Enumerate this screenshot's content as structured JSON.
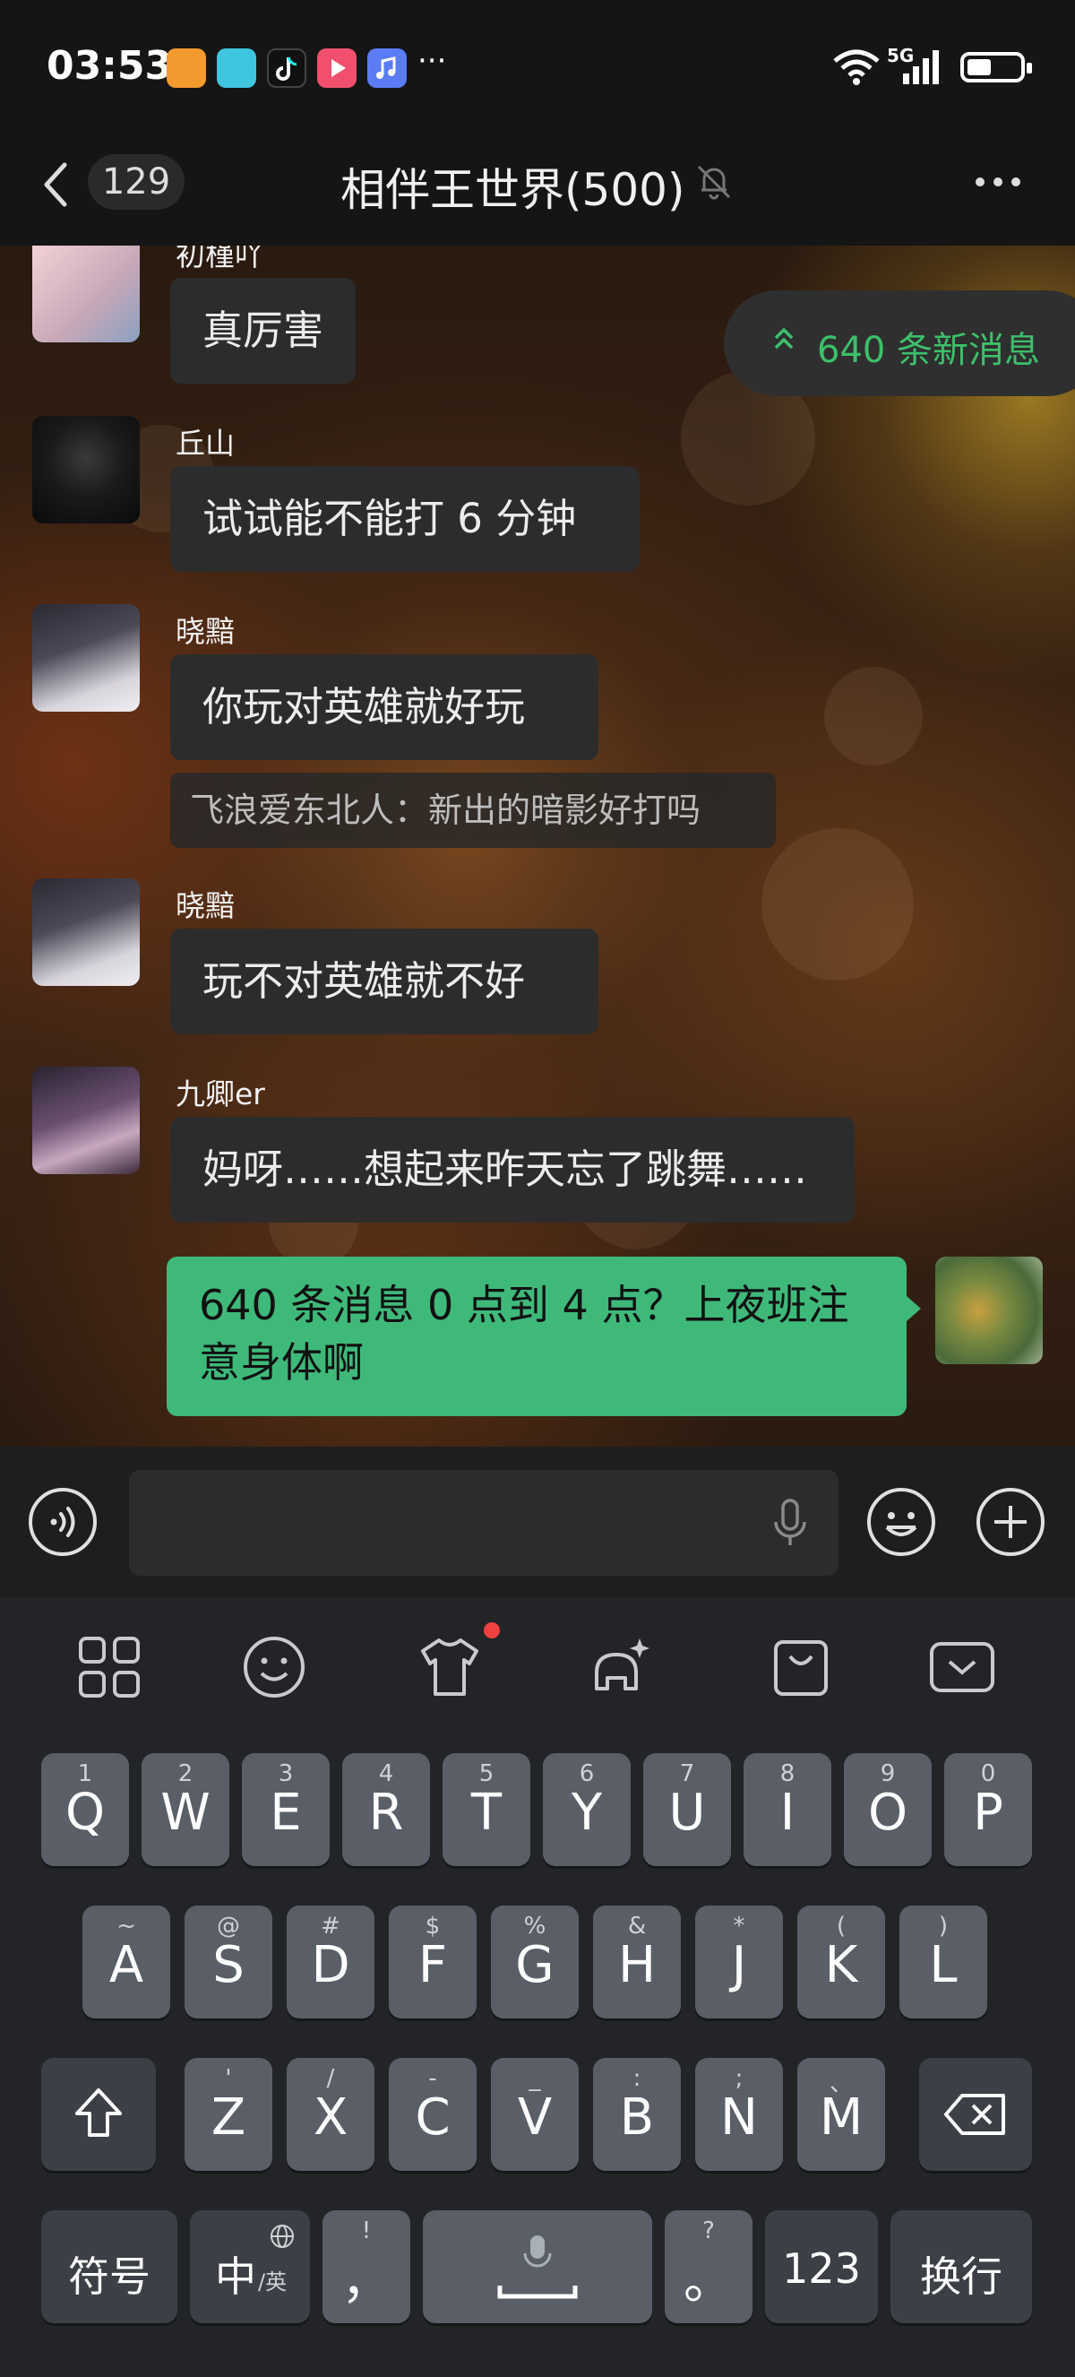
{
  "status_bar": {
    "time": "03:53",
    "network": "5G",
    "more": "···"
  },
  "header": {
    "unread_count": "129",
    "title": "相伴王世界(500)"
  },
  "new_messages_pill": "640 条新消息",
  "messages": [
    {
      "sender": "初槿吖",
      "text": "真厉害"
    },
    {
      "sender": "丘山",
      "text": "试试能不能打 6 分钟"
    },
    {
      "sender": "晓黯",
      "text": "你玩对英雄就好玩",
      "quote": "飞浪爱东北人：新出的暗影好打吗"
    },
    {
      "sender": "晓黯",
      "text": "玩不对英雄就不好"
    },
    {
      "sender": "九卿er",
      "text": "妈呀……想起来昨天忘了跳舞……"
    }
  ],
  "my_message": "640 条消息 0 点到 4 点？上夜班注意身体啊",
  "keyboard": {
    "row1": [
      {
        "main": "Q",
        "sub": "1"
      },
      {
        "main": "W",
        "sub": "2"
      },
      {
        "main": "E",
        "sub": "3"
      },
      {
        "main": "R",
        "sub": "4"
      },
      {
        "main": "T",
        "sub": "5"
      },
      {
        "main": "Y",
        "sub": "6"
      },
      {
        "main": "U",
        "sub": "7"
      },
      {
        "main": "I",
        "sub": "8"
      },
      {
        "main": "O",
        "sub": "9"
      },
      {
        "main": "P",
        "sub": "0"
      }
    ],
    "row2": [
      {
        "main": "A",
        "sub": "~"
      },
      {
        "main": "S",
        "sub": "@"
      },
      {
        "main": "D",
        "sub": "#"
      },
      {
        "main": "F",
        "sub": "$"
      },
      {
        "main": "G",
        "sub": "%"
      },
      {
        "main": "H",
        "sub": "&"
      },
      {
        "main": "J",
        "sub": "*"
      },
      {
        "main": "K",
        "sub": "("
      },
      {
        "main": "L",
        "sub": ")"
      }
    ],
    "row3": [
      {
        "main": "Z",
        "sub": "'"
      },
      {
        "main": "X",
        "sub": "/"
      },
      {
        "main": "C",
        "sub": "-"
      },
      {
        "main": "V",
        "sub": "_"
      },
      {
        "main": "B",
        "sub": ":"
      },
      {
        "main": "N",
        "sub": ";"
      },
      {
        "main": "M",
        "sub": "、"
      }
    ],
    "symbols": "符号",
    "lang_main": "中",
    "lang_sub": "/英",
    "comma": "，",
    "comma_sub": "!",
    "period": "。",
    "period_sub": "?",
    "numbers": "123",
    "enter": "换行"
  },
  "colors": {
    "accent_green": "#3fb97a",
    "pill_text": "#3cc06a"
  }
}
